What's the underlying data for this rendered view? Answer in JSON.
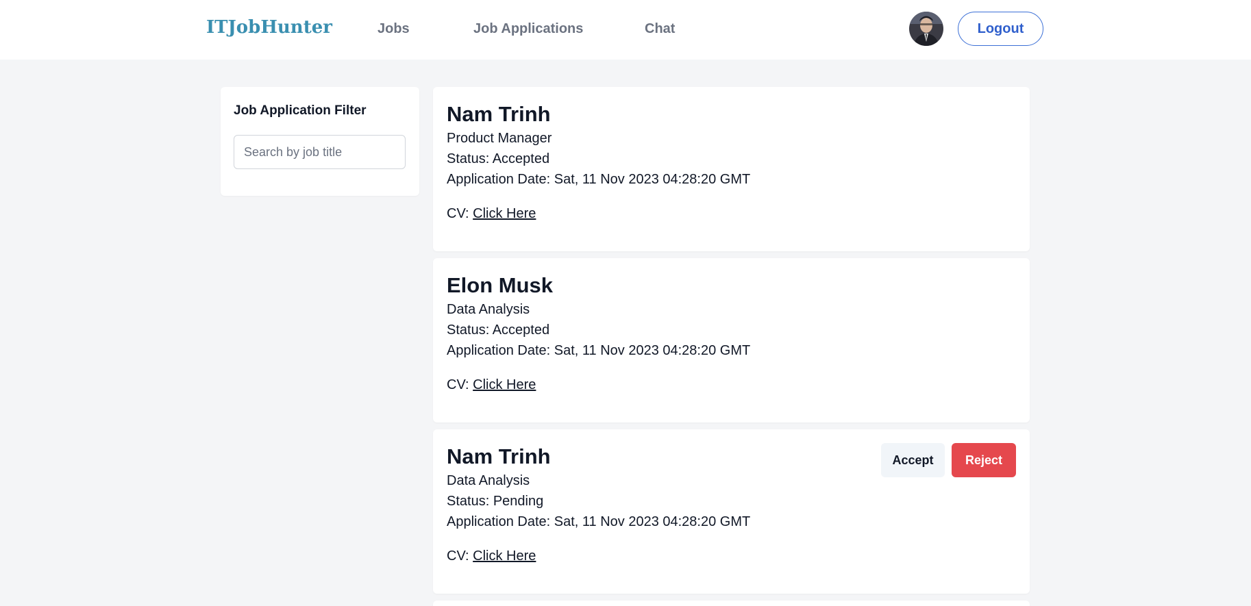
{
  "nav": {
    "brand": "ITJobHunter",
    "links": [
      "Jobs",
      "Job Applications",
      "Chat"
    ],
    "logout_label": "Logout"
  },
  "filter": {
    "title": "Job Application Filter",
    "search_placeholder": "Search by job title",
    "search_value": ""
  },
  "applications": [
    {
      "name": "Nam Trinh",
      "job_title": "Product Manager",
      "status": "Status: Accepted",
      "date": "Application Date: Sat, 11 Nov 2023 04:28:20 GMT",
      "cv_label": "CV: ",
      "cv_link": "Click Here"
    },
    {
      "name": "Elon Musk",
      "job_title": "Data Analysis",
      "status": "Status: Accepted",
      "date": "Application Date: Sat, 11 Nov 2023 04:28:20 GMT",
      "cv_label": "CV: ",
      "cv_link": "Click Here"
    },
    {
      "name": "Nam Trinh",
      "job_title": "Data Analysis",
      "status": "Status: Pending",
      "date": "Application Date: Sat, 11 Nov 2023 04:28:20 GMT",
      "cv_label": "CV: ",
      "cv_link": "Click Here",
      "accept_label": "Accept",
      "reject_label": "Reject"
    }
  ],
  "colors": {
    "brand": "#3a8fb0",
    "logout_border": "#3b6fd6",
    "reject": "#e5484d",
    "accept_bg": "#f1f5f9",
    "page_bg": "#f4f5f7"
  },
  "icons": {
    "avatar": "user-avatar-icon"
  }
}
